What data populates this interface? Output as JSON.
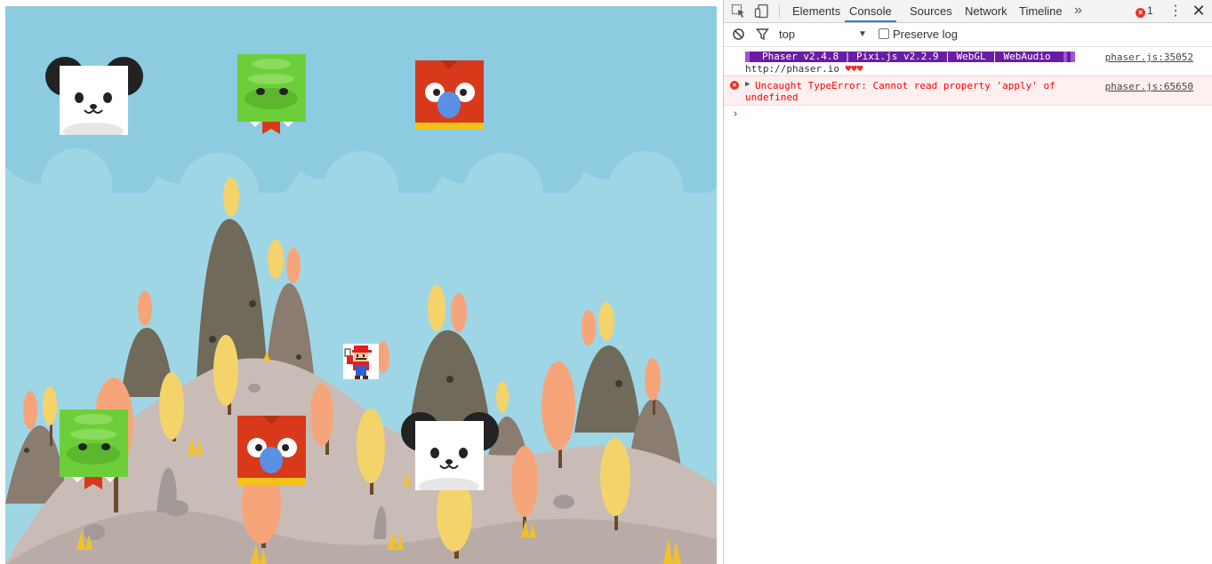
{
  "devtools": {
    "tabs": [
      {
        "label": "Elements",
        "active": false
      },
      {
        "label": "Console",
        "active": true
      },
      {
        "label": "Sources",
        "active": false
      },
      {
        "label": "Network",
        "active": false
      },
      {
        "label": "Timeline",
        "active": false
      }
    ],
    "overflow_label": "»",
    "error_count": "1",
    "menu_label": "⋮",
    "close_label": "✕",
    "filter": {
      "context": "top",
      "preserve_log_label": "Preserve log",
      "preserve_log_checked": false
    },
    "messages": [
      {
        "type": "log",
        "banner": "Phaser v2.4.8 | Pixi.js v2.2.9 | WebGL | WebAudio",
        "line2": "http://phaser.io",
        "hearts": "♥♥♥",
        "source": "phaser.js:35052"
      },
      {
        "type": "error",
        "text_line1": "Uncaught TypeError: Cannot read property 'apply' of",
        "text_line2": "undefined",
        "source": "phaser.js:65650"
      }
    ],
    "prompt": "›"
  },
  "game": {
    "sprites": [
      "panda",
      "dragon",
      "parrot",
      "panda",
      "dragon",
      "parrot",
      "mario"
    ],
    "colors": {
      "sky": "#9fd6e6",
      "dragon": "#6ccf3a",
      "parrot": "#d8391a",
      "panda_ear": "#222222",
      "accent_error": "#e0362c",
      "active_tab": "#3879d9"
    }
  }
}
